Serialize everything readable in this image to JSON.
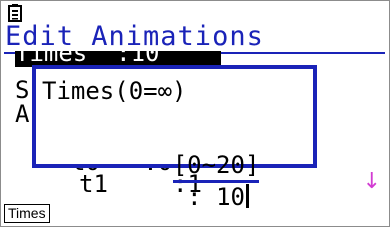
{
  "status_bar": {
    "icon": "battery-icon"
  },
  "title": "Edit Animations",
  "background_rows": {
    "partial_top": "Times  :10",
    "s_letter": "S",
    "a_letter": "A",
    "t0_partial": "t0   :0",
    "t1_label": "t1",
    "t1_value": ":1"
  },
  "dialog": {
    "title": "Times(0=∞)",
    "range": "[0~20]",
    "separator": ":",
    "value": "10"
  },
  "scroll_indicator": "↓",
  "function_keys": {
    "f1": "Times"
  },
  "colors": {
    "title_blue": "#1a23b8",
    "arrow_magenta": "#d23cd2"
  }
}
